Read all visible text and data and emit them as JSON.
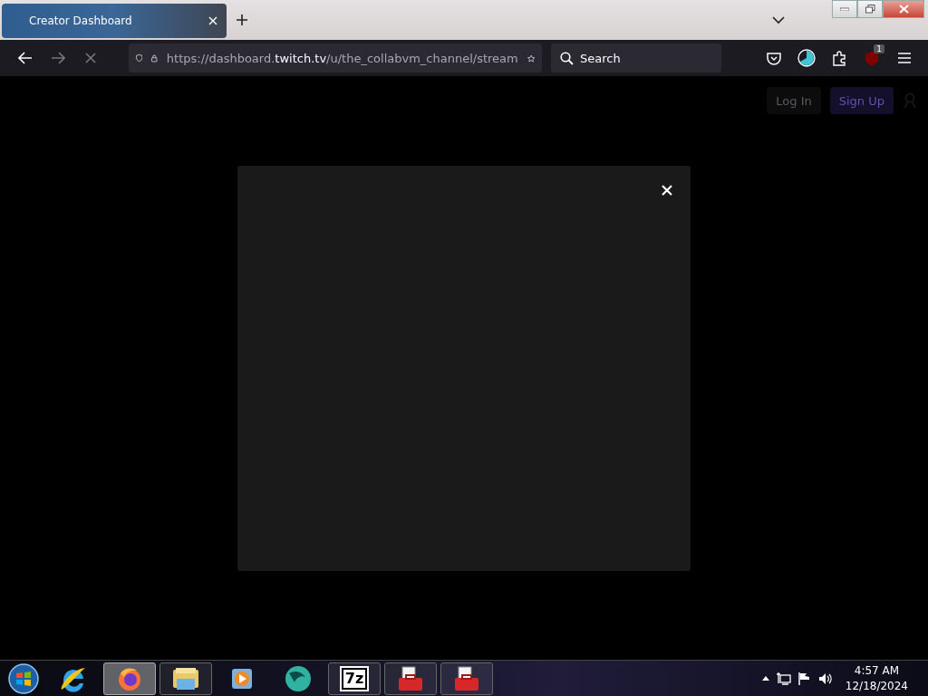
{
  "browser": {
    "tabs": [
      {
        "title": "Creator Dashboard",
        "selected": true
      }
    ],
    "toolbar": {
      "url": "https://dashboard.**twitch.tv**/u/the_collabvm_channel/stream",
      "search_placeholder": "Search",
      "extension_badge": "1",
      "loading": true
    }
  },
  "page": {
    "header_buttons": [
      {
        "label": "Log In",
        "kind": "secondary"
      },
      {
        "label": "Sign Up",
        "kind": "primary"
      }
    ],
    "modal": {
      "open": true
    }
  },
  "taskbar": {
    "apps": [
      {
        "kind": "ie",
        "running": false,
        "selected": false
      },
      {
        "kind": "firefox",
        "running": true,
        "selected": true
      },
      {
        "kind": "explorer",
        "running": true,
        "selected": false
      },
      {
        "kind": "media",
        "running": false,
        "selected": false
      },
      {
        "kind": "globe",
        "running": false,
        "selected": false
      },
      {
        "kind": "archiver",
        "label": "7z",
        "running": true,
        "selected": false
      },
      {
        "kind": "toolbox",
        "running": true,
        "selected": false
      },
      {
        "kind": "toolbox",
        "running": true,
        "selected": false
      }
    ],
    "clock": {
      "time": "4:57 AM",
      "date": "12/18/2024"
    }
  }
}
